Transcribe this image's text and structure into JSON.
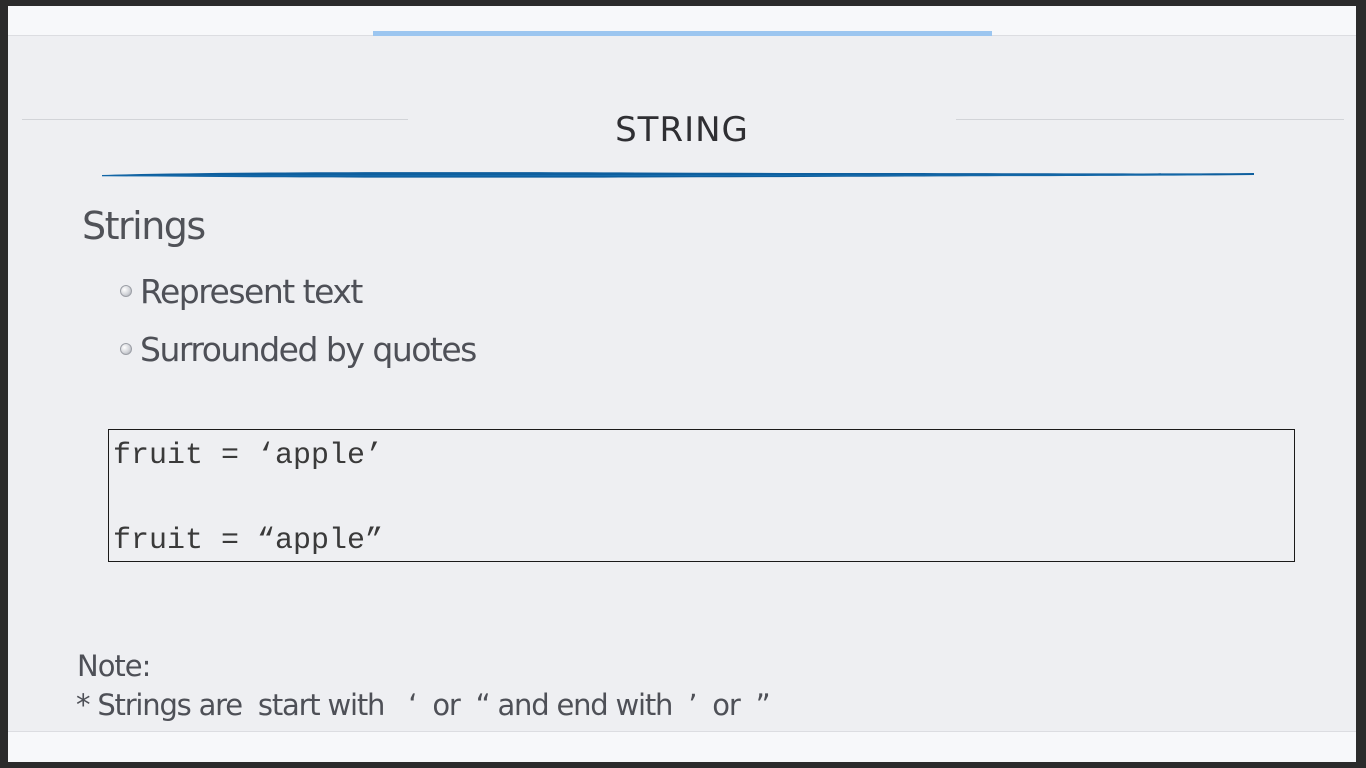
{
  "slide": {
    "title": "STRING",
    "heading": "Strings",
    "bullets": [
      {
        "label": "Represent text"
      },
      {
        "label": "Surrounded by quotes"
      }
    ],
    "code_lines": [
      "fruit = ‘apple’",
      "fruit = “apple”"
    ],
    "note_label": "Note:",
    "note_text": "* Strings are  start with   ‘  or  “ and end with  ’  or  ”"
  },
  "colors": {
    "accent": "#0e5f9e",
    "progress": "#9cc6f0",
    "background": "#eeeff2",
    "text": "#4e5057"
  }
}
